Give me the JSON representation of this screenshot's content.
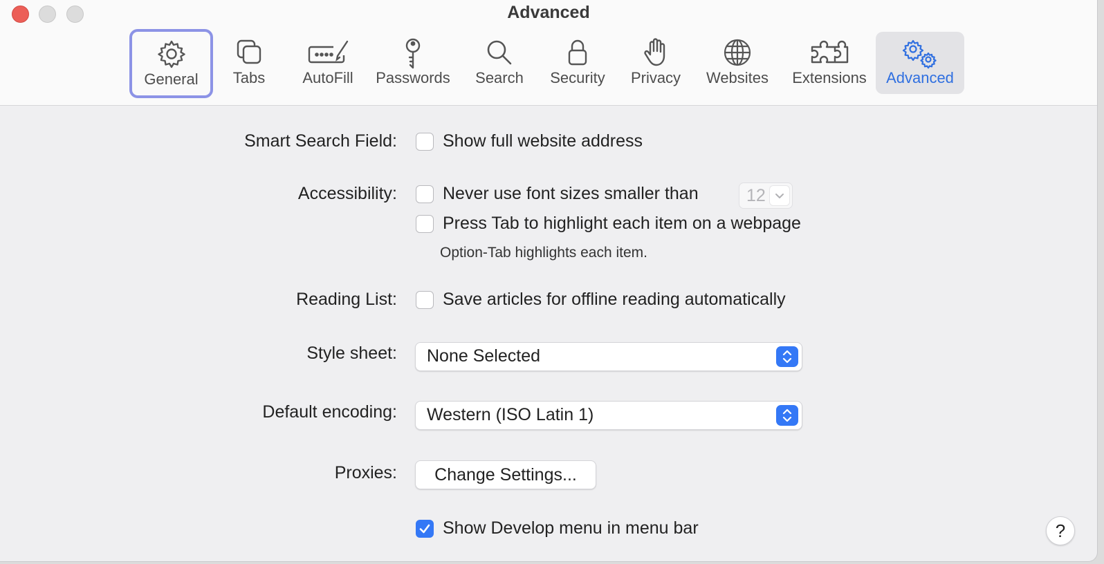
{
  "window": {
    "title": "Advanced"
  },
  "toolbar": {
    "tabs": [
      {
        "label": "General",
        "icon": "gear-icon"
      },
      {
        "label": "Tabs",
        "icon": "tabs-icon"
      },
      {
        "label": "AutoFill",
        "icon": "autofill-icon"
      },
      {
        "label": "Passwords",
        "icon": "key-icon"
      },
      {
        "label": "Search",
        "icon": "magnifier-icon"
      },
      {
        "label": "Security",
        "icon": "lock-icon"
      },
      {
        "label": "Privacy",
        "icon": "hand-icon"
      },
      {
        "label": "Websites",
        "icon": "globe-icon"
      },
      {
        "label": "Extensions",
        "icon": "puzzle-icon"
      },
      {
        "label": "Advanced",
        "icon": "gears-icon"
      }
    ],
    "focused_tab": "General",
    "selected_tab": "Advanced"
  },
  "settings": {
    "smart_search": {
      "label": "Smart Search Field:",
      "option": "Show full website address",
      "checked": false
    },
    "accessibility": {
      "label": "Accessibility:",
      "font_option": "Never use font sizes smaller than",
      "font_checked": false,
      "font_size": "12",
      "tab_option": "Press Tab to highlight each item on a webpage",
      "tab_checked": false,
      "tab_note": "Option-Tab highlights each item."
    },
    "reading_list": {
      "label": "Reading List:",
      "option": "Save articles for offline reading automatically",
      "checked": false
    },
    "style_sheet": {
      "label": "Style sheet:",
      "value": "None Selected"
    },
    "encoding": {
      "label": "Default encoding:",
      "value": "Western (ISO Latin 1)"
    },
    "proxies": {
      "label": "Proxies:",
      "button": "Change Settings..."
    },
    "develop_menu": {
      "option": "Show Develop menu in menu bar",
      "checked": true
    }
  },
  "help": {
    "label": "?"
  },
  "colors": {
    "accent": "#3478f6",
    "focus_ring": "#8c93e6",
    "close": "#ec5f58"
  }
}
